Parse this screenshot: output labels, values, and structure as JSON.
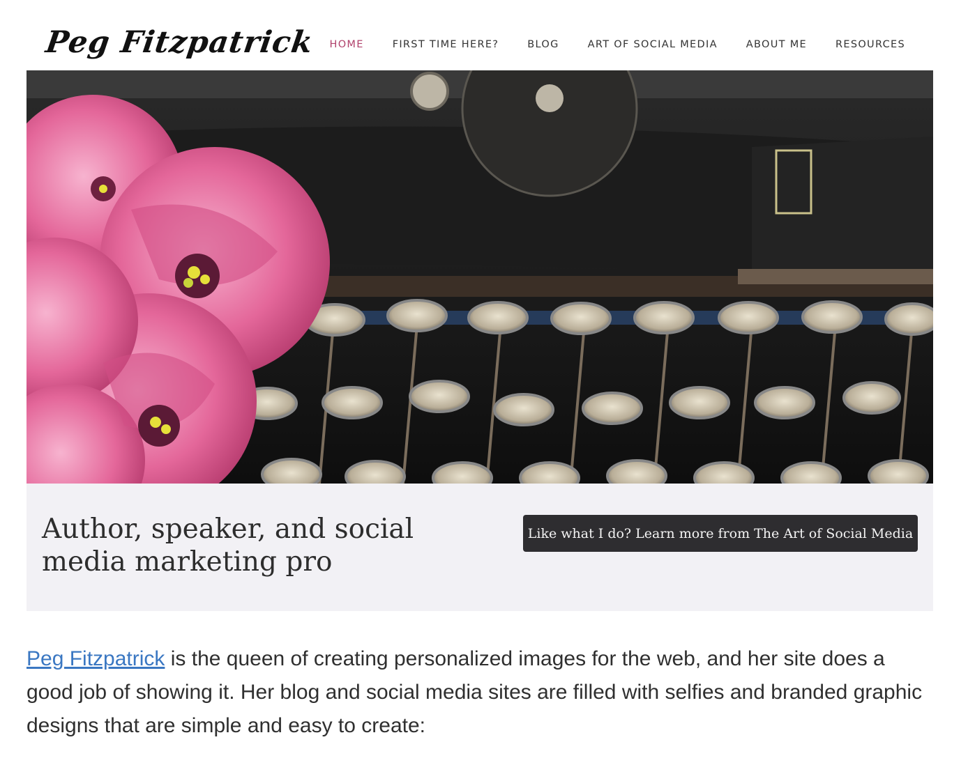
{
  "site": {
    "logo_text": "Peg Fitzpatrick",
    "nav": [
      {
        "label": "HOME",
        "active": true
      },
      {
        "label": "FIRST TIME HERE?",
        "active": false
      },
      {
        "label": "BLOG",
        "active": false
      },
      {
        "label": "ART OF SOCIAL MEDIA",
        "active": false
      },
      {
        "label": "ABOUT ME",
        "active": false
      },
      {
        "label": "RESOURCES",
        "active": false
      }
    ]
  },
  "hero": {
    "image_subject": "pink-flowers-and-typewriter-keys-photo"
  },
  "band": {
    "tagline": "Author, speaker, and social media marketing pro",
    "cta_label": "Like what I do? Learn more from The Art of Social Media"
  },
  "article": {
    "link_text": "Peg Fitzpatrick",
    "body_text": " is the queen of creating personalized images for the web, and her site does a good job of showing it. Her blog and social media sites are filled with selfies and branded graphic designs that are simple and easy to create:"
  },
  "colors": {
    "nav_active": "#b0416b",
    "button_bg": "#2e2d30",
    "band_bg": "#f2f1f5",
    "link": "#3a77c2"
  }
}
